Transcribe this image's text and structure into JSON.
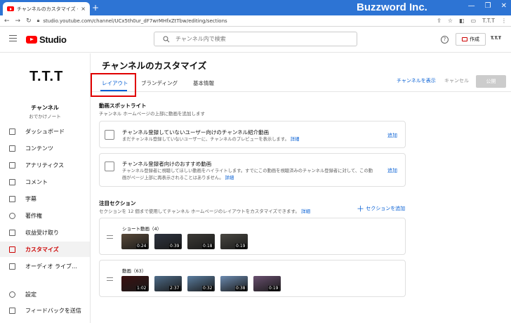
{
  "browser": {
    "tab_title": "チャンネルのカスタマイズ - YouTube S",
    "tab_close": "×",
    "new_tab": "+",
    "window_controls": [
      "—",
      "❐",
      "✕"
    ],
    "url": "studio.youtube.com/channel/UCx5th0ur_dF7wrMHfxZtTbw/editing/sections",
    "watermark": "Buzzword Inc."
  },
  "header": {
    "logo_text": "Studio",
    "search_placeholder": "チャンネル内で検索",
    "help": "?",
    "create_label": "作成",
    "avatar_text": "T.T.T"
  },
  "sidebar": {
    "avatar_text": "T.T.T",
    "channel_label": "チャンネル",
    "channel_sub": "おでかけノート",
    "items": [
      {
        "label": "ダッシュボード",
        "icon": "dashboard-icon"
      },
      {
        "label": "コンテンツ",
        "icon": "content-icon"
      },
      {
        "label": "アナリティクス",
        "icon": "analytics-icon"
      },
      {
        "label": "コメント",
        "icon": "comment-icon"
      },
      {
        "label": "字幕",
        "icon": "subtitles-icon"
      },
      {
        "label": "著作権",
        "icon": "copyright-icon"
      },
      {
        "label": "収益受け取り",
        "icon": "monetization-icon"
      },
      {
        "label": "カスタマイズ",
        "icon": "customize-icon",
        "active": true
      },
      {
        "label": "オーディオ ライブ…",
        "icon": "audio-library-icon"
      },
      {
        "label": "設定",
        "icon": "settings-icon"
      },
      {
        "label": "フィードバックを送信",
        "icon": "feedback-icon"
      }
    ]
  },
  "main": {
    "title": "チャンネルのカスタマイズ",
    "tabs": [
      "レイアウト",
      "ブランディング",
      "基本情報"
    ],
    "view_channel": "チャンネルを表示",
    "cancel": "キャンセル",
    "publish": "公開",
    "spotlight": {
      "title": "動画スポットライト",
      "desc": "チャンネル ホームページの上部に動画を追加します",
      "cards": [
        {
          "title": "チャンネル登録していないユーザー向けのチャンネル紹介動画",
          "desc": "まだチャンネル登録していないユーザーに、チャンネルのプレビューを表示します。",
          "link": "詳細",
          "add": "追加"
        },
        {
          "title": "チャンネル登録者向けのおすすめ動画",
          "desc1": "チャンネル登録者に視聴してほしい動画をハイライトします。すでにこの動画を視聴済みのチャンネル登録者に対して、この動",
          "desc2": "画がページ上部に再表示されることはありません。",
          "link": "詳細",
          "add": "追加"
        }
      ]
    },
    "featured": {
      "title": "注目セクション",
      "desc": "セクションを 12 個まで使用してチャンネル ホームページのレイアウトをカスタマイズできます。",
      "link": "詳細",
      "add_section": "セクションを追加",
      "rows": [
        {
          "title": "ショート動画（4）",
          "thumbs": [
            {
              "dur": "0:24",
              "bg": "#5a4a3a"
            },
            {
              "dur": "0:39",
              "bg": "#2e3440"
            },
            {
              "dur": "0:18",
              "bg": "#3c3a36"
            },
            {
              "dur": "0:19",
              "bg": "#4a4842"
            }
          ]
        },
        {
          "title": "動画（63）",
          "thumbs": [
            {
              "dur": "1:02",
              "bg": "#3a1010"
            },
            {
              "dur": "2:37",
              "bg": "#4f6d8a"
            },
            {
              "dur": "0:32",
              "bg": "#5b7ea0"
            },
            {
              "dur": "0:38",
              "bg": "#6c8bb0"
            },
            {
              "dur": "0:19",
              "bg": "#6a5070"
            }
          ]
        }
      ]
    }
  },
  "colors": {
    "accent": "#065fd4",
    "active": "#cc0000",
    "highlight_box": "#e00000",
    "browser": "#2d74d4"
  }
}
